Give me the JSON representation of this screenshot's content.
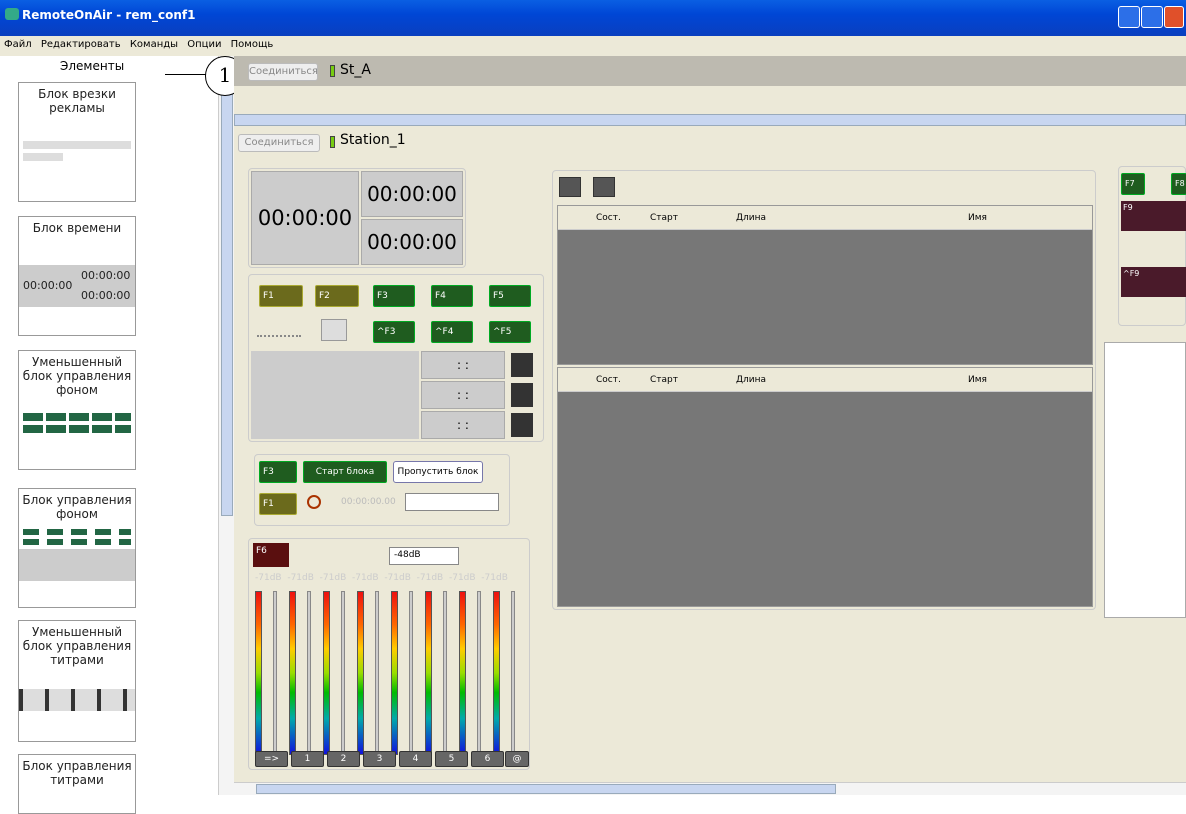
{
  "window": {
    "title": "RemoteOnAir - rem_conf1"
  },
  "menu": [
    "Файл",
    "Редактировать",
    "Команды",
    "Опции",
    "Помощь"
  ],
  "left": {
    "header": "Элементы",
    "cards": [
      "Блок врезки рекламы",
      "Блок времени",
      "Уменьшенный блок управления фоном",
      "Блок управления фоном",
      "Уменьшенный блок управления титрами",
      "Блок управления титрами"
    ],
    "time_main": "00:00:00",
    "time_small": "00:00:00"
  },
  "callout": "1",
  "top": {
    "connect": "Соединиться",
    "station": "St_A"
  },
  "station1": {
    "connect": "Соединиться",
    "name": "Station_1"
  },
  "timers": {
    "main": "00:00:00",
    "top": "00:00:00",
    "bottom": "00:00:00"
  },
  "fbuttons": {
    "row1": [
      "F1",
      "F2",
      "F3",
      "F4",
      "F5"
    ],
    "row2": [
      "^F3",
      "^F4",
      "^F5"
    ]
  },
  "colons": [
    ": :",
    ": :",
    ": :"
  ],
  "block": {
    "f3": "F3",
    "start": "Старт блока",
    "skip": "Пропустить блок",
    "f1": "F1",
    "time": "00:00:00.00"
  },
  "audio": {
    "f6": "F6",
    "level": "-48dB",
    "db": [
      "-71dB",
      "-71dB",
      "-71dB",
      "-71dB",
      "-71dB",
      "-71dB",
      "-71dB",
      "-71dB"
    ],
    "buttons": [
      "=>",
      "1",
      "2",
      "3",
      "4",
      "5",
      "6",
      "@"
    ]
  },
  "playlist": {
    "columns": [
      "Сост.",
      "Старт",
      "Длина",
      "Имя"
    ]
  },
  "right": {
    "f7": "F7",
    "f8": "F8",
    "f9": "F9",
    "cf9": "^F9"
  },
  "colors": {
    "titlebar": "#0046d5",
    "panel": "#ece9d8",
    "table": "#777777"
  }
}
